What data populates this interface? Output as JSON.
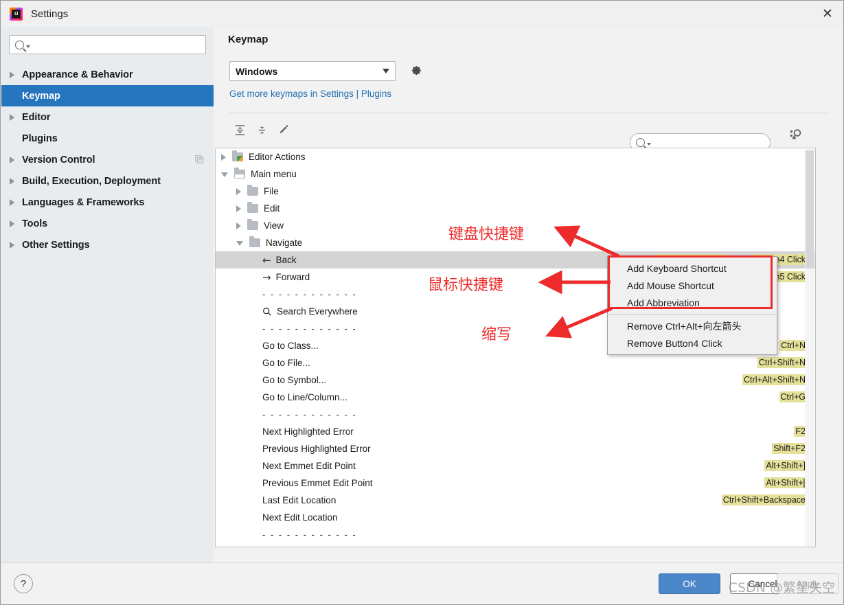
{
  "window": {
    "title": "Settings",
    "logo_icon": "intellij-idea-logo-icon",
    "close_icon": "close-icon"
  },
  "sidebar": {
    "search": {
      "placeholder": "",
      "value": "",
      "icon": "search-icon"
    },
    "items": [
      {
        "label": "Appearance & Behavior",
        "expandable": true,
        "selected": false
      },
      {
        "label": "Keymap",
        "expandable": false,
        "selected": true
      },
      {
        "label": "Editor",
        "expandable": true,
        "selected": false
      },
      {
        "label": "Plugins",
        "expandable": false,
        "selected": false
      },
      {
        "label": "Version Control",
        "expandable": true,
        "selected": false,
        "trailing_icon": "copy-icon"
      },
      {
        "label": "Build, Execution, Deployment",
        "expandable": true,
        "selected": false
      },
      {
        "label": "Languages & Frameworks",
        "expandable": true,
        "selected": false
      },
      {
        "label": "Tools",
        "expandable": true,
        "selected": false
      },
      {
        "label": "Other Settings",
        "expandable": true,
        "selected": false
      }
    ]
  },
  "panel": {
    "title": "Keymap",
    "keymap_select": {
      "value": "Windows",
      "icon": "chevron-down-icon"
    },
    "gear_icon": "gear-icon",
    "link": "Get more keymaps in Settings | Plugins",
    "toolbar": [
      {
        "icon": "expand-all-icon"
      },
      {
        "icon": "collapse-all-icon"
      },
      {
        "icon": "edit-pencil-icon"
      }
    ],
    "search": {
      "placeholder": "",
      "value": "",
      "icon": "search-icon"
    },
    "find_shortcut_icon": "find-by-shortcut-icon"
  },
  "tree": [
    {
      "indent": 0,
      "toggle": "collapsed",
      "icon": "editor-actions-folder-icon",
      "label": "Editor Actions",
      "badge": "",
      "selected": false
    },
    {
      "indent": 0,
      "toggle": "expanded",
      "icon": "main-menu-folder-icon",
      "label": "Main menu",
      "badge": "",
      "selected": false
    },
    {
      "indent": 1,
      "toggle": "collapsed",
      "icon": "folder-icon",
      "label": "File",
      "badge": "",
      "selected": false
    },
    {
      "indent": 1,
      "toggle": "collapsed",
      "icon": "folder-icon",
      "label": "Edit",
      "badge": "",
      "selected": false
    },
    {
      "indent": 1,
      "toggle": "collapsed",
      "icon": "folder-icon",
      "label": "View",
      "badge": "",
      "selected": false
    },
    {
      "indent": 1,
      "toggle": "expanded",
      "icon": "folder-icon",
      "label": "Navigate",
      "badge": "",
      "selected": false
    },
    {
      "indent": 2,
      "toggle": "none",
      "icon": "arrow-left-icon",
      "label": "Back",
      "badge": "Button4 Click",
      "badge2": "Ctrl+Alt+向左箭头",
      "selected": true
    },
    {
      "indent": 2,
      "toggle": "none",
      "icon": "arrow-right-icon",
      "label": "Forward",
      "badge": "Button5 Click",
      "selected": false
    },
    {
      "indent": 2,
      "toggle": "none",
      "icon": "separator",
      "label": "- - - - - - - - - - - -",
      "badge": "",
      "selected": false
    },
    {
      "indent": 2,
      "toggle": "none",
      "icon": "search-icon",
      "label": "Search Everywhere",
      "badge": "",
      "selected": false
    },
    {
      "indent": 2,
      "toggle": "none",
      "icon": "separator",
      "label": "- - - - - - - - - - - -",
      "badge": "",
      "selected": false
    },
    {
      "indent": 2,
      "toggle": "none",
      "icon": "",
      "label": "Go to Class...",
      "badge": "Ctrl+N",
      "selected": false
    },
    {
      "indent": 2,
      "toggle": "none",
      "icon": "",
      "label": "Go to File...",
      "badge": "Ctrl+Shift+N",
      "selected": false
    },
    {
      "indent": 2,
      "toggle": "none",
      "icon": "",
      "label": "Go to Symbol...",
      "badge": "Ctrl+Alt+Shift+N",
      "selected": false
    },
    {
      "indent": 2,
      "toggle": "none",
      "icon": "",
      "label": "Go to Line/Column...",
      "badge": "Ctrl+G",
      "selected": false
    },
    {
      "indent": 2,
      "toggle": "none",
      "icon": "separator",
      "label": "- - - - - - - - - - - -",
      "badge": "",
      "selected": false
    },
    {
      "indent": 2,
      "toggle": "none",
      "icon": "",
      "label": "Next Highlighted Error",
      "badge": "F2",
      "selected": false
    },
    {
      "indent": 2,
      "toggle": "none",
      "icon": "",
      "label": "Previous Highlighted Error",
      "badge": "Shift+F2",
      "selected": false
    },
    {
      "indent": 2,
      "toggle": "none",
      "icon": "",
      "label": "Next Emmet Edit Point",
      "badge": "Alt+Shift+]",
      "selected": false
    },
    {
      "indent": 2,
      "toggle": "none",
      "icon": "",
      "label": "Previous Emmet Edit Point",
      "badge": "Alt+Shift+[",
      "selected": false
    },
    {
      "indent": 2,
      "toggle": "none",
      "icon": "",
      "label": "Last Edit Location",
      "badge": "Ctrl+Shift+Backspace",
      "selected": false
    },
    {
      "indent": 2,
      "toggle": "none",
      "icon": "",
      "label": "Next Edit Location",
      "badge": "",
      "selected": false
    },
    {
      "indent": 2,
      "toggle": "none",
      "icon": "separator",
      "label": "- - - - - - - - - - - -",
      "badge": "",
      "selected": false
    }
  ],
  "context_menu": {
    "items": [
      {
        "label": "Add Keyboard Shortcut",
        "separator_after": false
      },
      {
        "label": "Add Mouse Shortcut",
        "separator_after": false
      },
      {
        "label": "Add Abbreviation",
        "separator_after": true
      },
      {
        "label": "Remove Ctrl+Alt+向左箭头",
        "separator_after": false
      },
      {
        "label": "Remove Button4 Click",
        "separator_after": false
      }
    ]
  },
  "annotations": {
    "color": "#ee2b2b",
    "labels": [
      {
        "text": "键盘快捷键",
        "target": "Add Keyboard Shortcut"
      },
      {
        "text": "鼠标快捷键",
        "target": "Add Mouse Shortcut"
      },
      {
        "text": "缩写",
        "target": "Add Abbreviation"
      }
    ]
  },
  "footer": {
    "help_icon": "help-question-icon",
    "ok_label": "OK",
    "cancel_label": "Cancel",
    "apply_label": "Apply",
    "ok_color": "#4a86c8"
  },
  "watermark": "CSDN @繁星失空"
}
